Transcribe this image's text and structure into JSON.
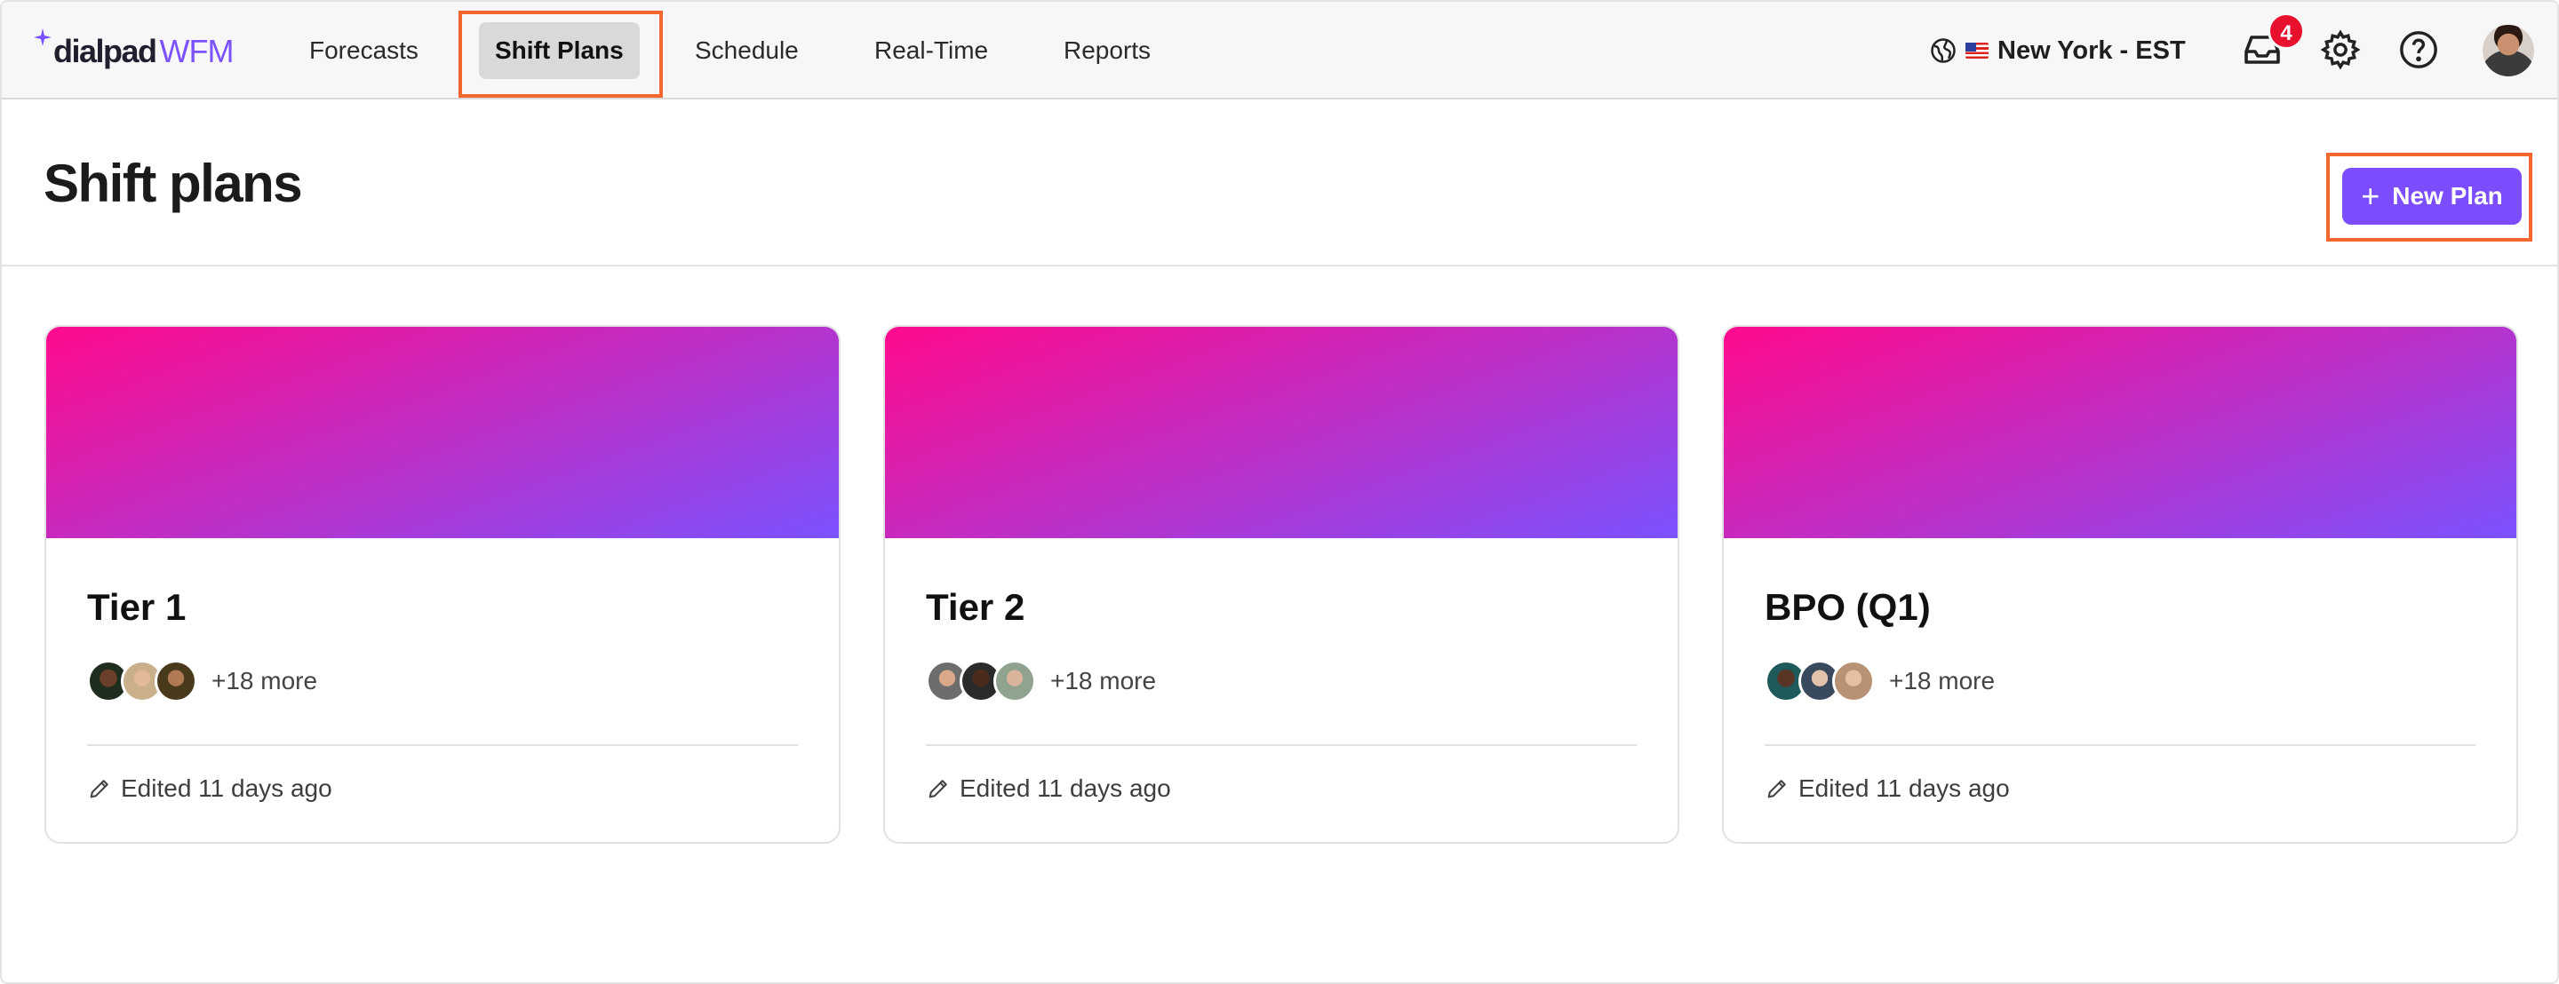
{
  "app": {
    "logo_primary": "dialpad",
    "logo_secondary": "WFM"
  },
  "nav": {
    "items": [
      {
        "label": "Forecasts",
        "active": false
      },
      {
        "label": "Shift Plans",
        "active": true
      },
      {
        "label": "Schedule",
        "active": false
      },
      {
        "label": "Real-Time",
        "active": false
      },
      {
        "label": "Reports",
        "active": false
      }
    ],
    "timezone": "New York - EST",
    "notifications_count": "4",
    "icons": [
      "globe-icon",
      "us-flag-icon",
      "inbox-icon",
      "gear-icon",
      "help-icon",
      "user-avatar"
    ]
  },
  "page": {
    "title": "Shift plans",
    "new_plan_label": "New Plan"
  },
  "cards": [
    {
      "title": "Tier 1",
      "more": "+18 more",
      "edited": "Edited 11 days ago"
    },
    {
      "title": "Tier 2",
      "more": "+18 more",
      "edited": "Edited 11 days ago"
    },
    {
      "title": "BPO (Q1)",
      "more": "+18 more",
      "edited": "Edited 11 days ago"
    }
  ],
  "colors": {
    "accent": "#7b4dff",
    "highlight": "#f2672e",
    "badge": "#e8112d",
    "banner_start": "#ff0a8c",
    "banner_end": "#7b52ff"
  }
}
